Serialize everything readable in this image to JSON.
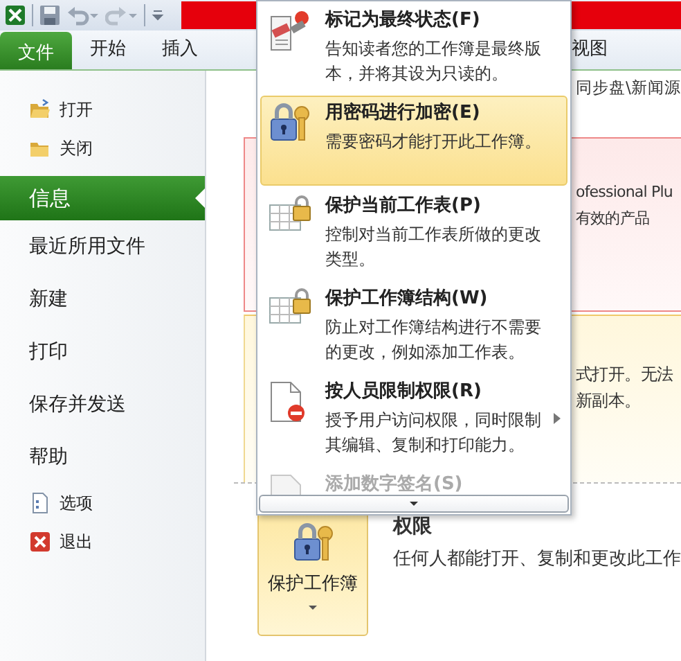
{
  "ribbon_tabs": [
    {
      "label": "文件",
      "selected": true
    },
    {
      "label": "开始",
      "selected": false
    },
    {
      "label": "插入",
      "selected": false
    },
    {
      "label": "视图",
      "selected": false
    }
  ],
  "sidebar": {
    "items": [
      {
        "label": "打开",
        "kind": "open",
        "selected": false
      },
      {
        "label": "关闭",
        "kind": "close",
        "selected": false
      },
      {
        "label": "信息",
        "kind": "page",
        "selected": true
      },
      {
        "label": "最近所用文件",
        "kind": "page",
        "selected": false
      },
      {
        "label": "新建",
        "kind": "page",
        "selected": false
      },
      {
        "label": "打印",
        "kind": "page",
        "selected": false
      },
      {
        "label": "保存并发送",
        "kind": "page",
        "selected": false
      },
      {
        "label": "帮助",
        "kind": "page",
        "selected": false
      },
      {
        "label": "选项",
        "kind": "options",
        "selected": false
      },
      {
        "label": "退出",
        "kind": "exit",
        "selected": false
      }
    ]
  },
  "info_page": {
    "path": "同步盘\\新闻源",
    "notice_lines": [
      "ofessional Plu",
      "有效的产品"
    ],
    "compat_lines": [
      "式打开。无法",
      "新副本。"
    ],
    "protect_button": {
      "label": "保护工作簿",
      "expanded": true
    },
    "permissions": {
      "title": "权限",
      "description": "任何人都能打开、复制和更改此工作"
    }
  },
  "protect_menu": {
    "items": [
      {
        "kind": "final",
        "title": "标记为最终状态(F)",
        "description": "告知读者您的工作簿是最终版本，并将其设为只读的。",
        "selected": false,
        "disabled": false,
        "submenu": false
      },
      {
        "kind": "password",
        "title": "用密码进行加密(E)",
        "description": "需要密码才能打开此工作簿。",
        "selected": true,
        "disabled": false,
        "submenu": false
      },
      {
        "kind": "sheet",
        "title": "保护当前工作表(P)",
        "description": "控制对当前工作表所做的更改类型。",
        "selected": false,
        "disabled": false,
        "submenu": false
      },
      {
        "kind": "structure",
        "title": "保护工作簿结构(W)",
        "description": "防止对工作簿结构进行不需要的更改，例如添加工作表。",
        "selected": false,
        "disabled": false,
        "submenu": false
      },
      {
        "kind": "permission",
        "title": "按人员限制权限(R)",
        "description": "授予用户访问权限，同时限制其编辑、复制和打印能力。",
        "selected": false,
        "disabled": false,
        "submenu": true
      },
      {
        "kind": "signature",
        "title": "添加数字签名(S)",
        "selected": false,
        "disabled": true,
        "submenu": false
      }
    ]
  }
}
